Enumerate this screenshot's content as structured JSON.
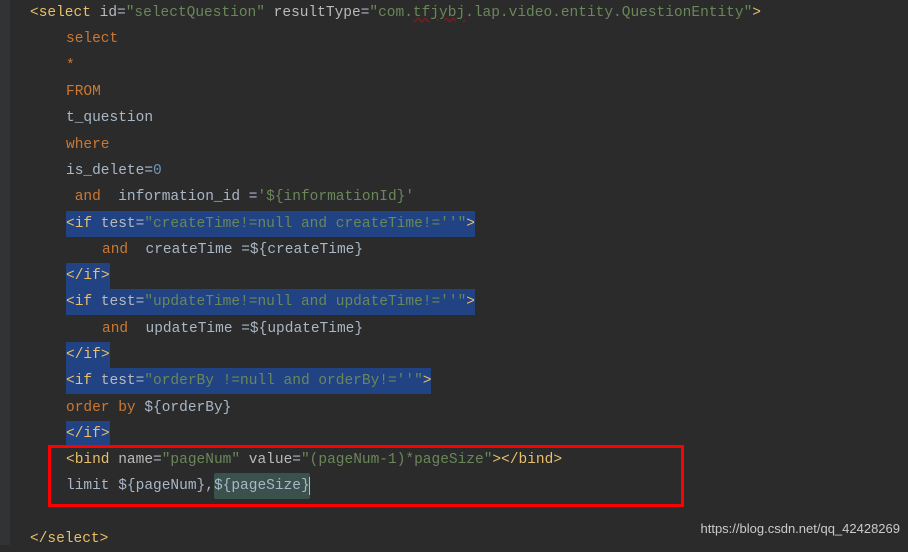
{
  "code": {
    "select_tag": {
      "open": "<",
      "name": "select",
      "id_attr": "id",
      "id_val": "\"selectQuestion\"",
      "rt_attr": "resultType",
      "rt_val_pre": "\"com.",
      "rt_val_u": "tfjybj",
      "rt_val_post": ".lap.video.entity.QuestionEntity\"",
      "close": ">"
    },
    "kw_select": "select",
    "star": "*",
    "kw_from": "FROM",
    "t_question": "t_question",
    "kw_where": "where",
    "is_delete": "is_delete=",
    "zero": "0",
    "and1": " and  ",
    "info_id": "information_id =",
    "info_str": "'${informationId}'",
    "if1": {
      "open": "<",
      "name": "if",
      "attr": "test",
      "val": "\"createTime!=null and createTime!=''\"",
      "close": ">"
    },
    "and2": "and  ",
    "ct_eq": "createTime =${createTime}",
    "endif": "</",
    "if_name": "if",
    "gt": ">",
    "if2": {
      "val": "\"updateTime!=null and updateTime!=''\""
    },
    "ut_eq": "updateTime =${updateTime}",
    "if3": {
      "val": "\"orderBy !=null and orderBy!=''\""
    },
    "orderby_kw": "order by ",
    "orderby_expr": "${orderBy}",
    "bind": {
      "name": "bind",
      "name_attr": "name",
      "name_val": "\"pageNum\"",
      "val_attr": "value",
      "val_val": "\"(pageNum-1)*pageSize\"",
      "close_open": "</",
      "close_gt": ">"
    },
    "limit": "limit ${pageNum}",
    "comma": ",",
    "pagesize": "${pageSize}",
    "select_close": "</",
    "select_name": "select",
    "watermark": "https://blog.csdn.net/qq_42428269"
  }
}
